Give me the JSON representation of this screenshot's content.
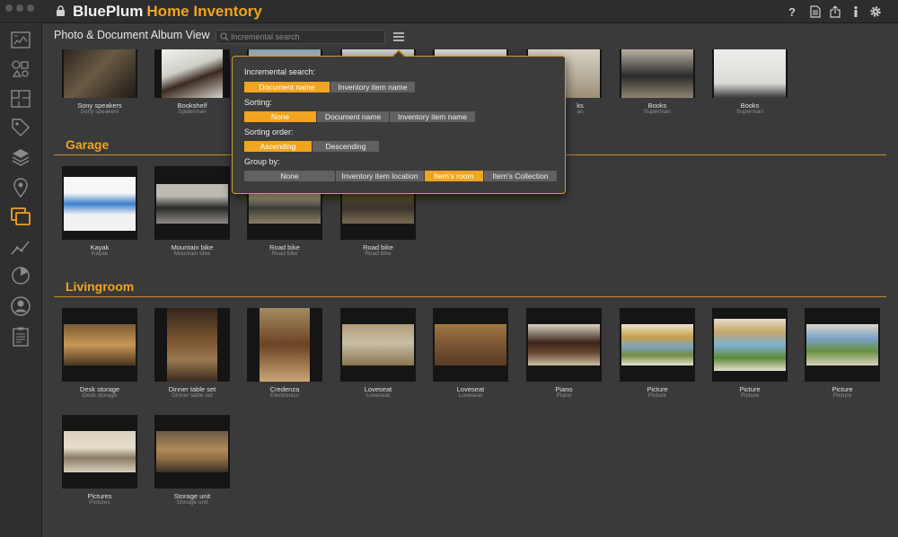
{
  "window": {
    "brand": "BluePlum",
    "app_name": "Home Inventory"
  },
  "titlebar_icons": [
    "help-icon",
    "document-icon",
    "export-icon",
    "info-icon",
    "settings-icon"
  ],
  "sidebar": {
    "items": [
      "dashboard-icon",
      "items-icon",
      "floorplan-icon",
      "tags-icon",
      "collections-icon",
      "location-icon",
      "album-icon",
      "chart-icon",
      "pie-chart-icon",
      "user-icon",
      "report-icon"
    ],
    "selected": "album-icon"
  },
  "toolbar": {
    "view_title": "Photo & Document Album View",
    "search_placeholder": "Incremental search",
    "search_value": ""
  },
  "colors": {
    "accent": "#f0a420",
    "background": "#3a3a3a",
    "sidebar": "#2f2f2f"
  },
  "groups": [
    {
      "title": "",
      "items": [
        {
          "label": "Sony speakers",
          "sub": "Sony speakers"
        },
        {
          "label": "Bookshelf",
          "sub": "Spiderman"
        },
        {
          "label": "",
          "sub": ""
        },
        {
          "label": "",
          "sub": ""
        },
        {
          "label": "",
          "sub": ""
        },
        {
          "label": "ks",
          "sub": "an"
        },
        {
          "label": "Books",
          "sub": "Superman"
        },
        {
          "label": "Books",
          "sub": "Superman"
        }
      ]
    },
    {
      "title": "Garage",
      "items": [
        {
          "label": "Kayak",
          "sub": "Kayak"
        },
        {
          "label": "Mountain bike",
          "sub": "Mountain bike"
        },
        {
          "label": "Road bike",
          "sub": "Road bike"
        },
        {
          "label": "Road bike",
          "sub": "Road bike"
        }
      ]
    },
    {
      "title": "Livingroom",
      "items": [
        {
          "label": "Desk storage",
          "sub": "Desk storage"
        },
        {
          "label": "Dinner table set",
          "sub": "Dinner table set"
        },
        {
          "label": "Credenza",
          "sub": "Electronics"
        },
        {
          "label": "Loveseat",
          "sub": "Loveseat"
        },
        {
          "label": "Loveseat",
          "sub": "Loveseat"
        },
        {
          "label": "Piano",
          "sub": "Piano"
        },
        {
          "label": "Picture",
          "sub": "Picture"
        },
        {
          "label": "Picture",
          "sub": "Picture"
        },
        {
          "label": "Picture",
          "sub": "Picture"
        },
        {
          "label": "Pictures",
          "sub": "Pictures"
        },
        {
          "label": "Storage unit",
          "sub": "Storage unit"
        }
      ]
    }
  ],
  "popover": {
    "search_label": "Incremental search:",
    "search_options": [
      "Document name",
      "Inventory item name"
    ],
    "search_selected": 0,
    "sorting_label": "Sorting:",
    "sorting_options": [
      "None",
      "Document name",
      "Inventory item name"
    ],
    "sorting_selected": 0,
    "order_label": "Sorting order:",
    "order_options": [
      "Ascending",
      "Descending"
    ],
    "order_selected": 0,
    "group_label": "Group by:",
    "group_options": [
      "None",
      "Inventory item location",
      "Item's room",
      "Item's Collection"
    ],
    "group_selected": 2
  }
}
